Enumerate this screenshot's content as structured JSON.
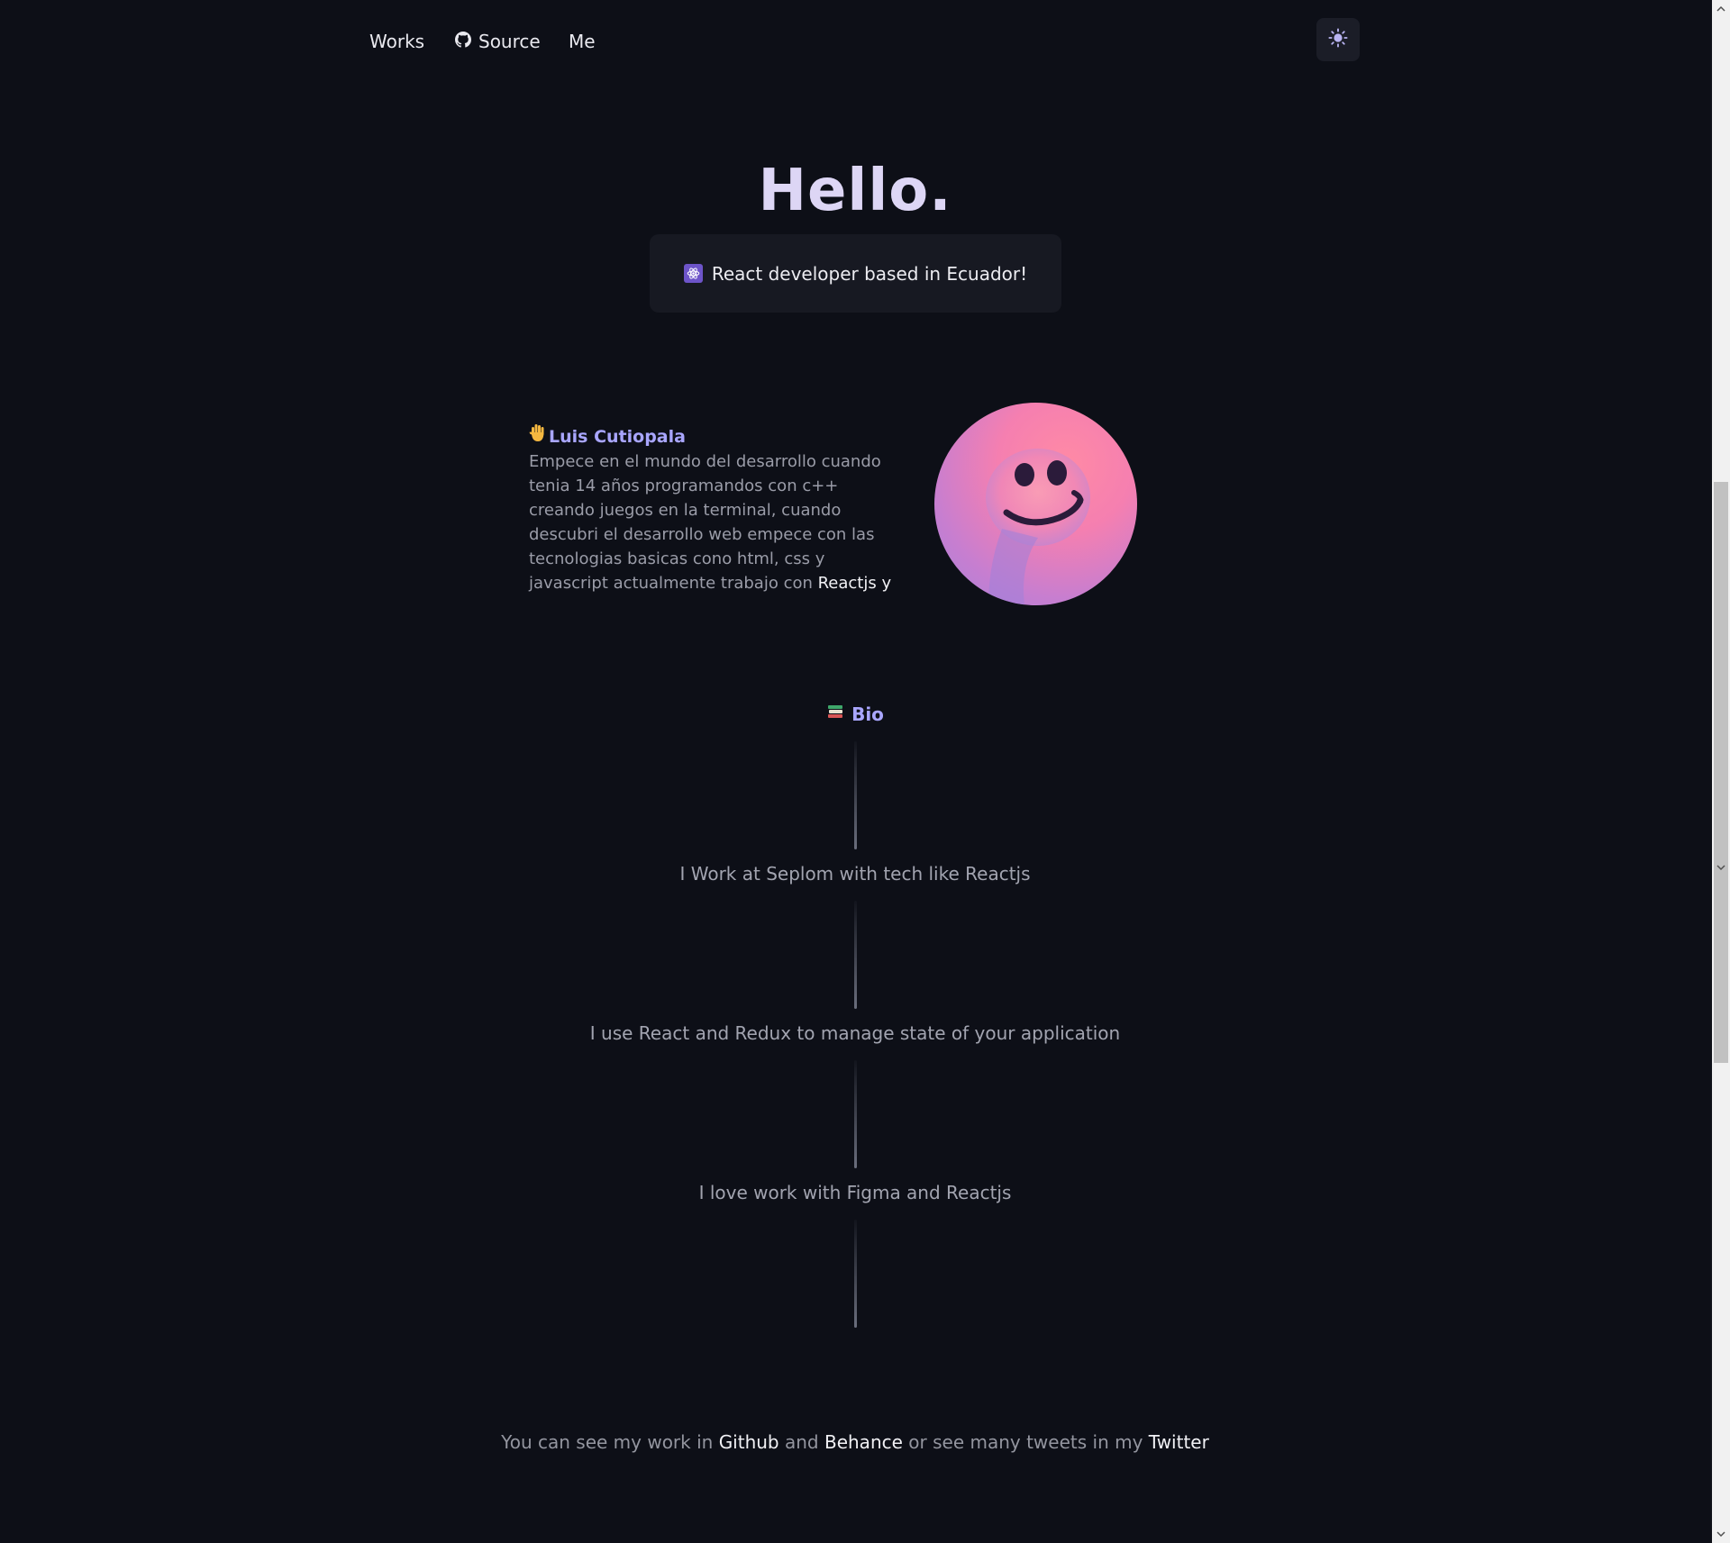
{
  "nav": {
    "works": "Works",
    "source": "Source",
    "me": "Me",
    "theme_icon": "sun-icon"
  },
  "hero": {
    "title": "Hello.",
    "tagline_icon": "react-icon",
    "tagline": "React developer based in Ecuador!"
  },
  "intro": {
    "icon": "raised-hand-emoji",
    "name": "Luis Cutiopala",
    "text": "Empece en el mundo del desarrollo cuando tenia 14 años programandos con c++ creando juegos en la terminal, cuando descubri el desarrollo web empece con las tecnologias basicas cono html, css y javascript actualmente trabajo con ",
    "highlight": "Reactjs y"
  },
  "bio": {
    "icon": "books-emoji",
    "title": "Bio",
    "items": [
      "I Work at Seplom with tech like Reactjs",
      "I use React and Redux to manage state of your application",
      "I love work with Figma and Reactjs"
    ]
  },
  "footer": {
    "prefix": "You can see my work in ",
    "github": "Github",
    "and": " and ",
    "behance": "Behance",
    "middle": " or see many tweets in my ",
    "twitter": "Twitter"
  },
  "colors": {
    "background": "#0d0f17",
    "accent": "#a9a6ff",
    "title": "#ddd6f5"
  }
}
